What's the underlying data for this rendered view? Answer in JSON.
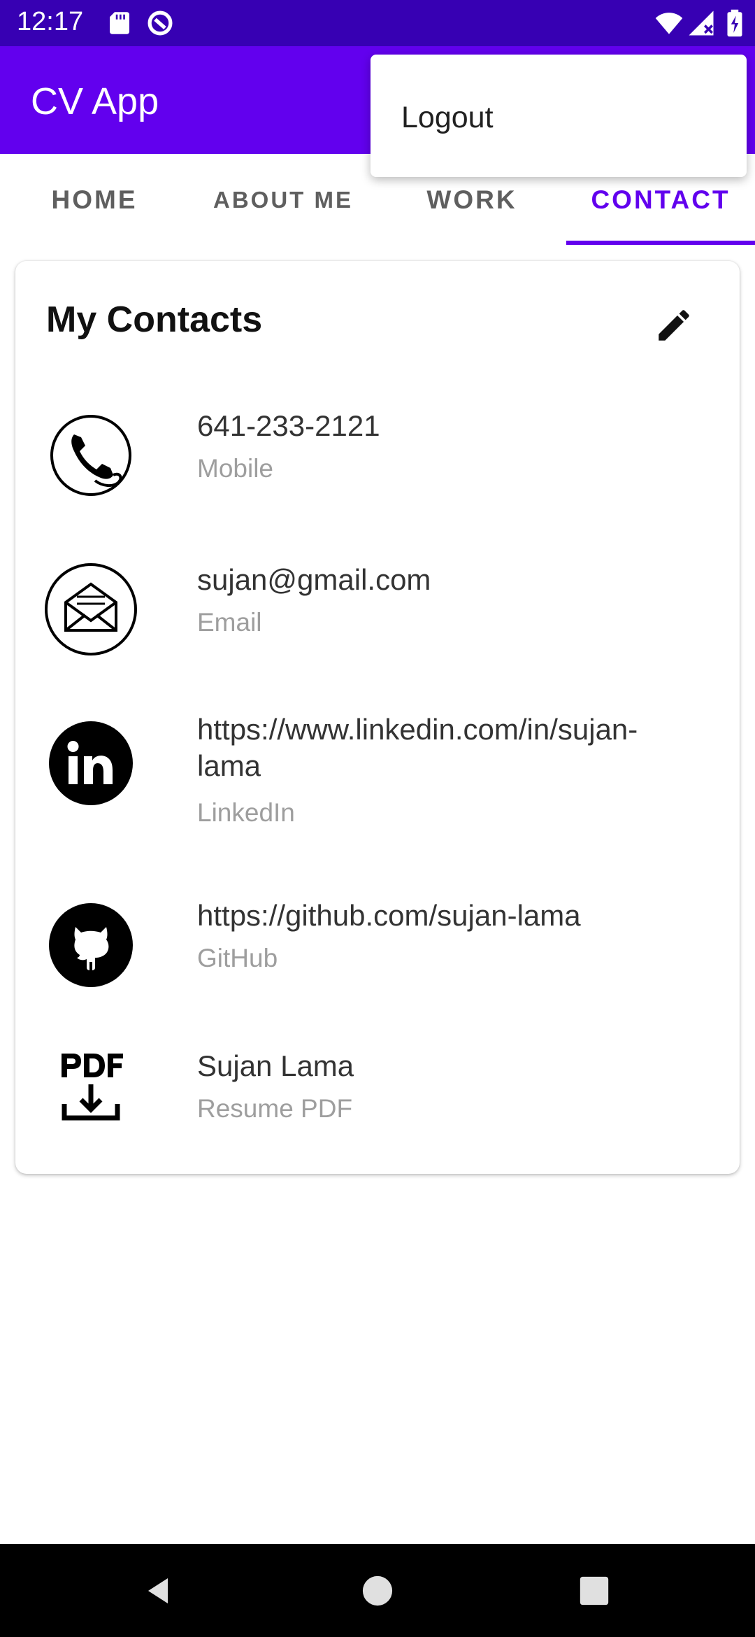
{
  "status_bar": {
    "time": "12:17",
    "icons": [
      "sd-card-icon",
      "data-saver-icon",
      "wifi-icon",
      "signal-icon",
      "battery-charging-icon"
    ]
  },
  "app_bar": {
    "title": "CV App",
    "background": "#6200EE"
  },
  "tabs": [
    {
      "label": "HOME",
      "active": false
    },
    {
      "label": "ABOUT ME",
      "active": false
    },
    {
      "label": "WORK",
      "active": false
    },
    {
      "label": "CONTACT",
      "active": true
    }
  ],
  "card": {
    "title": "My Contacts",
    "edit_icon": "pencil-icon",
    "contacts": [
      {
        "value": "641-233-2121",
        "label": "Mobile",
        "icon": "phone-icon"
      },
      {
        "value": "sujan@gmail.com",
        "label": "Email",
        "icon": "envelope-icon"
      },
      {
        "value": "https://www.linkedin.com/in/sujan-lama",
        "label": "LinkedIn",
        "icon": "linkedin-icon"
      },
      {
        "value": "https://github.com/sujan-lama",
        "label": "GitHub",
        "icon": "github-icon"
      },
      {
        "value": "Sujan Lama",
        "label": "Resume PDF",
        "icon": "pdf-download-icon"
      }
    ]
  },
  "popup_menu": {
    "items": [
      {
        "label": "Logout"
      }
    ]
  },
  "nav_bar": {
    "icons": [
      "back-icon",
      "home-icon",
      "recents-icon"
    ]
  },
  "colors": {
    "primary": "#6200EE",
    "primary_dark": "#3700B3",
    "secondary_text": "#9e9e9e"
  }
}
